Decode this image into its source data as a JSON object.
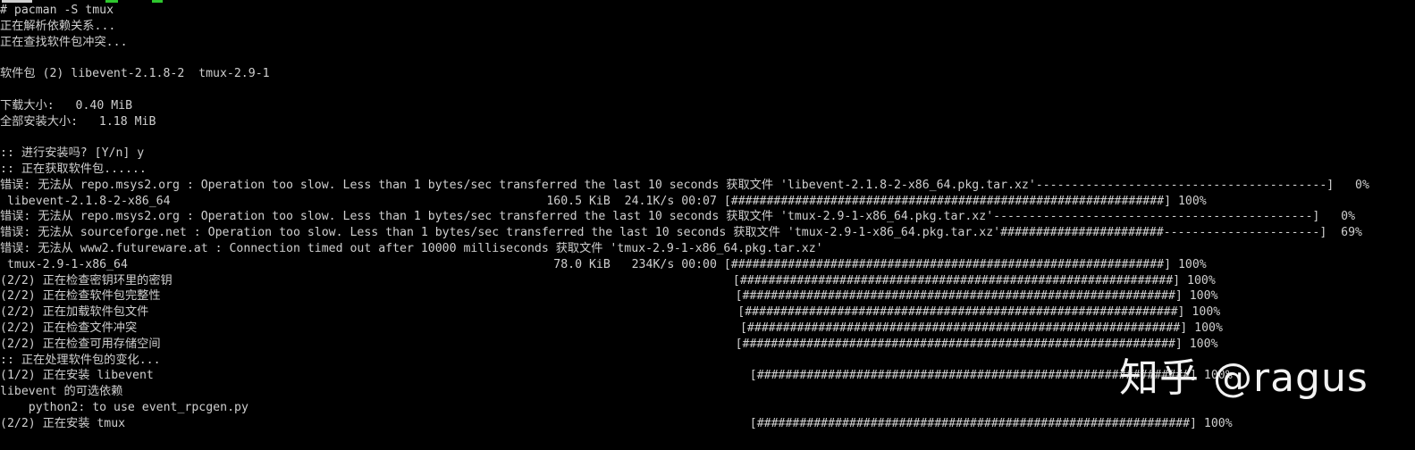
{
  "terminal": {
    "lines": [
      "# pacman -S tmux",
      "正在解析依赖关系...",
      "正在查找软件包冲突...",
      "",
      "软件包 (2) libevent-2.1.8-2  tmux-2.9-1",
      "",
      "下载大小:   0.40 MiB",
      "全部安装大小:   1.18 MiB",
      "",
      ":: 进行安装吗? [Y/n] y",
      ":: 正在获取软件包......",
      "错误: 无法从 repo.msys2.org : Operation too slow. Less than 1 bytes/sec transferred the last 10 seconds 获取文件 'libevent-2.1.8-2-x86_64.pkg.tar.xz'-----------------------------------------]   0%",
      " libevent-2.1.8-2-x86_64                                                     160.5 KiB  24.1K/s 00:07 [#############################################################] 100%",
      "错误: 无法从 repo.msys2.org : Operation too slow. Less than 1 bytes/sec transferred the last 10 seconds 获取文件 'tmux-2.9-1-x86_64.pkg.tar.xz'---------------------------------------------]   0%",
      "错误: 无法从 sourceforge.net : Operation too slow. Less than 1 bytes/sec transferred the last 10 seconds 获取文件 'tmux-2.9-1-x86_64.pkg.tar.xz'#######################----------------------]  69%",
      "错误: 无法从 www2.futureware.at : Connection timed out after 10000 milliseconds 获取文件 'tmux-2.9-1-x86_64.pkg.tar.xz'",
      " tmux-2.9-1-x86_64                                                            78.0 KiB   234K/s 00:00 [#############################################################] 100%",
      "(2/2) 正在检查密钥环里的密钥                                                                               [#############################################################] 100%",
      "(2/2) 正在检查软件包完整性                                                                                 [#############################################################] 100%",
      "(2/2) 正在加载软件包文件                                                                                   [#############################################################] 100%",
      "(2/2) 正在检查文件冲突                                                                                     [#############################################################] 100%",
      "(2/2) 正在检查可用存储空间                                                                                 [#############################################################] 100%",
      ":: 正在处理软件包的变化...",
      "(1/2) 正在安装 libevent                                                                                    [#############################################################] 100%",
      "libevent 的可选依赖",
      "    python2: to use event_rpcgen.py",
      "(2/2) 正在安装 tmux                                                                                        [#############################################################] 100%"
    ]
  },
  "watermark": {
    "text": "知乎 @ragus"
  },
  "colors": {
    "background": "#000000",
    "foreground": "#cfcfcf",
    "prompt_green": "#2ec62e",
    "watermark": "#f2f2f2"
  }
}
